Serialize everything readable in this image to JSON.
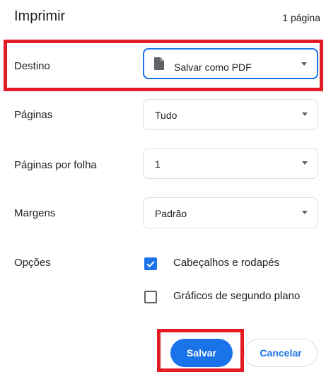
{
  "header": {
    "title": "Imprimir",
    "page_count": "1 página"
  },
  "settings": [
    {
      "label": "Destino",
      "value": "Salvar como PDF",
      "icon": "document-icon"
    },
    {
      "label": "Páginas",
      "value": "Tudo"
    },
    {
      "label": "Páginas por folha",
      "value": "1"
    },
    {
      "label": "Margens",
      "value": "Padrão"
    }
  ],
  "options": {
    "label": "Opções",
    "items": [
      {
        "label": "Cabeçalhos e rodapés",
        "checked": true
      },
      {
        "label": "Gráficos de segundo plano",
        "checked": false
      }
    ]
  },
  "actions": {
    "save_label": "Salvar",
    "cancel_label": "Cancelar"
  },
  "colors": {
    "accent": "#1a73e8",
    "highlight": "#e21b25"
  }
}
